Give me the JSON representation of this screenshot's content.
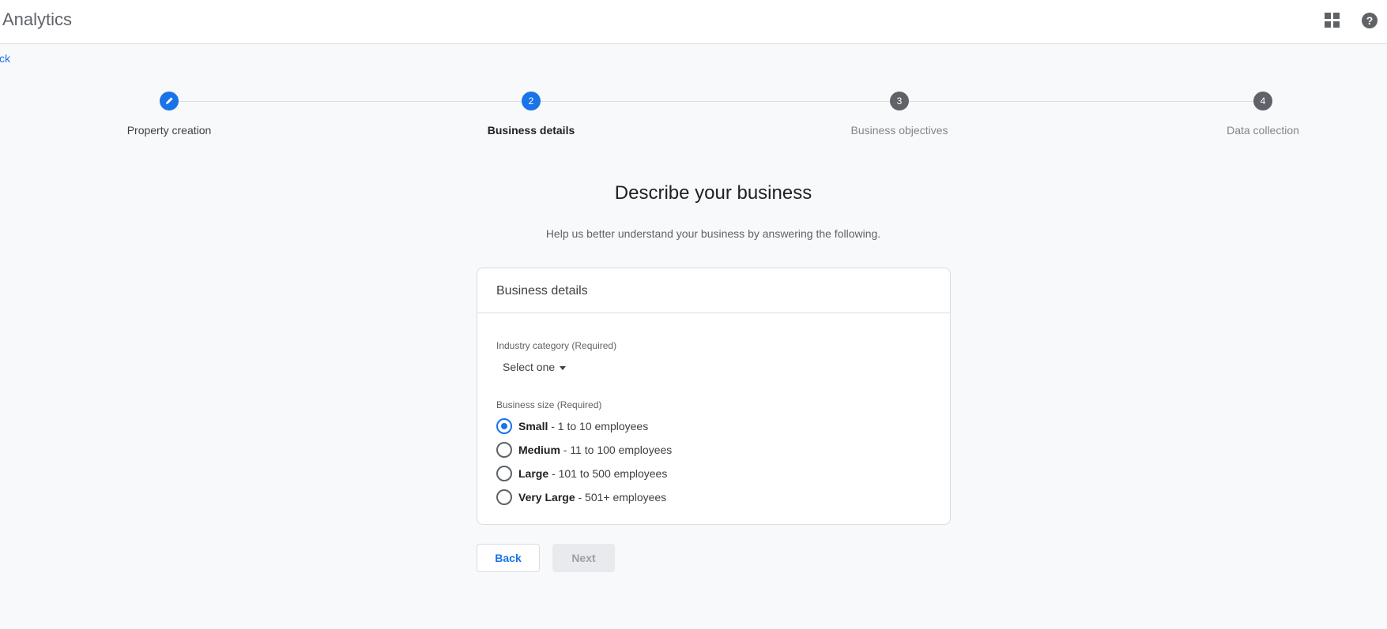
{
  "header": {
    "app_title": "Analytics",
    "apps_icon": "apps-grid-icon",
    "help_icon": "help-circle-icon"
  },
  "nav": {
    "back_link": "ck"
  },
  "stepper": {
    "steps": [
      {
        "number": "",
        "icon": "pencil-icon",
        "label": "Property creation",
        "state": "completed"
      },
      {
        "number": "2",
        "label": "Business details",
        "state": "active"
      },
      {
        "number": "3",
        "label": "Business objectives",
        "state": "upcoming"
      },
      {
        "number": "4",
        "label": "Data collection",
        "state": "upcoming"
      }
    ]
  },
  "page": {
    "title": "Describe your business",
    "subtitle": "Help us better understand your business by answering the following."
  },
  "card": {
    "header": "Business details",
    "industry": {
      "label": "Industry category (Required)",
      "value": "Select one"
    },
    "size": {
      "label": "Business size (Required)",
      "options": [
        {
          "name": "Small",
          "detail": " - 1 to 10 employees",
          "checked": true
        },
        {
          "name": "Medium",
          "detail": " - 11 to 100 employees",
          "checked": false
        },
        {
          "name": "Large",
          "detail": " - 101 to 500 employees",
          "checked": false
        },
        {
          "name": "Very Large",
          "detail": " - 501+ employees",
          "checked": false
        }
      ]
    }
  },
  "actions": {
    "back_label": "Back",
    "next_label": "Next"
  },
  "colors": {
    "accent": "#1a73e8",
    "step_inactive": "#5f6368",
    "next_disabled_bg": "#e8eaed"
  }
}
